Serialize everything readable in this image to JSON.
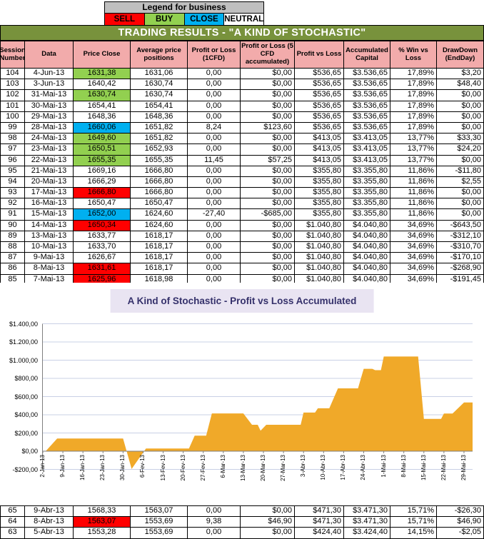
{
  "legend": {
    "title": "Legend for business",
    "items": [
      {
        "label": "SELL",
        "color": "#FF0000"
      },
      {
        "label": "BUY",
        "color": "#92D050"
      },
      {
        "label": "CLOSE",
        "color": "#00B0F0"
      },
      {
        "label": "NEUTRAL",
        "color": "#FFFFFF"
      }
    ]
  },
  "title_bar": "TRADING RESULTS - \"A KIND OF STOCHASTIC\"",
  "colors": {
    "header_pink": "#F2ABAB",
    "title_olive": "#78923C",
    "legend_gray": "#BFBFBF",
    "sell_red": "#FF0000",
    "buy_green": "#92D050",
    "close_blue": "#00B0F0",
    "grid": "#C9D0E5",
    "axis": "#7F7F7F",
    "chart_area": "#F0A929",
    "chart_title_bg": "#E9E4F2",
    "chart_title_text": "#35316B"
  },
  "table": {
    "headers": [
      "Session Number",
      "Data",
      "Price Close",
      "Average price positions",
      "Profit or Loss (1CFD)",
      "Profit or Loss (5 CFD accumulated)",
      "Profit vs Loss",
      "Accumulated Capital",
      "% Win vs Loss",
      "DrawDown (EndDay)"
    ],
    "rows_top": [
      {
        "cells": [
          "104",
          "4-Jun-13",
          "1631,38",
          "1631,06",
          "0,00",
          "$0,00",
          "$536,65",
          "$3.536,65",
          "17,89%",
          "$3,20"
        ],
        "price_color": "green"
      },
      {
        "cells": [
          "103",
          "3-Jun-13",
          "1640,42",
          "1630,74",
          "0,00",
          "$0,00",
          "$536,65",
          "$3.536,65",
          "17,89%",
          "$48,40"
        ],
        "price_color": "none"
      },
      {
        "cells": [
          "102",
          "31-Mai-13",
          "1630,74",
          "1630,74",
          "0,00",
          "$0,00",
          "$536,65",
          "$3.536,65",
          "17,89%",
          "$0,00"
        ],
        "price_color": "green"
      },
      {
        "cells": [
          "101",
          "30-Mai-13",
          "1654,41",
          "1654,41",
          "0,00",
          "$0,00",
          "$536,65",
          "$3.536,65",
          "17,89%",
          "$0,00"
        ],
        "price_color": "none"
      },
      {
        "cells": [
          "100",
          "29-Mai-13",
          "1648,36",
          "1648,36",
          "0,00",
          "$0,00",
          "$536,65",
          "$3.536,65",
          "17,89%",
          "$0,00"
        ],
        "price_color": "none"
      },
      {
        "cells": [
          "99",
          "28-Mai-13",
          "1660,06",
          "1651,82",
          "8,24",
          "$123,60",
          "$536,65",
          "$3.536,65",
          "17,89%",
          "$0,00"
        ],
        "price_color": "blue"
      },
      {
        "cells": [
          "98",
          "24-Mai-13",
          "1649,60",
          "1651,82",
          "0,00",
          "$0,00",
          "$413,05",
          "$3.413,05",
          "13,77%",
          "$33,30"
        ],
        "price_color": "green"
      },
      {
        "cells": [
          "97",
          "23-Mai-13",
          "1650,51",
          "1652,93",
          "0,00",
          "$0,00",
          "$413,05",
          "$3.413,05",
          "13,77%",
          "$24,20"
        ],
        "price_color": "green"
      },
      {
        "cells": [
          "96",
          "22-Mai-13",
          "1655,35",
          "1655,35",
          "11,45",
          "$57,25",
          "$413,05",
          "$3.413,05",
          "13,77%",
          "$0,00"
        ],
        "price_color": "green"
      },
      {
        "cells": [
          "95",
          "21-Mai-13",
          "1669,16",
          "1666,80",
          "0,00",
          "$0,00",
          "$355,80",
          "$3.355,80",
          "11,86%",
          "-$11,80"
        ],
        "price_color": "none"
      },
      {
        "cells": [
          "94",
          "20-Mai-13",
          "1666,29",
          "1666,80",
          "0,00",
          "$0,00",
          "$355,80",
          "$3.355,80",
          "11,86%",
          "$2,55"
        ],
        "price_color": "none"
      },
      {
        "cells": [
          "93",
          "17-Mai-13",
          "1666,80",
          "1666,80",
          "0,00",
          "$0,00",
          "$355,80",
          "$3.355,80",
          "11,86%",
          "$0,00"
        ],
        "price_color": "red"
      },
      {
        "cells": [
          "92",
          "16-Mai-13",
          "1650,47",
          "1650,47",
          "0,00",
          "$0,00",
          "$355,80",
          "$3.355,80",
          "11,86%",
          "$0,00"
        ],
        "price_color": "none"
      },
      {
        "cells": [
          "91",
          "15-Mai-13",
          "1652,00",
          "1624,60",
          "-27,40",
          "-$685,00",
          "$355,80",
          "$3.355,80",
          "11,86%",
          "$0,00"
        ],
        "price_color": "blue"
      },
      {
        "cells": [
          "90",
          "14-Mai-13",
          "1650,34",
          "1624,60",
          "0,00",
          "$0,00",
          "$1.040,80",
          "$4.040,80",
          "34,69%",
          "-$643,50"
        ],
        "price_color": "red"
      },
      {
        "cells": [
          "89",
          "13-Mai-13",
          "1633,77",
          "1618,17",
          "0,00",
          "$0,00",
          "$1.040,80",
          "$4.040,80",
          "34,69%",
          "-$312,10"
        ],
        "price_color": "none"
      },
      {
        "cells": [
          "88",
          "10-Mai-13",
          "1633,70",
          "1618,17",
          "0,00",
          "$0,00",
          "$1.040,80",
          "$4.040,80",
          "34,69%",
          "-$310,70"
        ],
        "price_color": "none"
      },
      {
        "cells": [
          "87",
          "9-Mai-13",
          "1626,67",
          "1618,17",
          "0,00",
          "$0,00",
          "$1.040,80",
          "$4.040,80",
          "34,69%",
          "-$170,10"
        ],
        "price_color": "none"
      },
      {
        "cells": [
          "86",
          "8-Mai-13",
          "1631,61",
          "1618,17",
          "0,00",
          "$0,00",
          "$1.040,80",
          "$4.040,80",
          "34,69%",
          "-$268,90"
        ],
        "price_color": "red"
      },
      {
        "cells": [
          "85",
          "7-Mai-13",
          "1625,96",
          "1618,98",
          "0,00",
          "$0,00",
          "$1.040,80",
          "$4.040,80",
          "34,69%",
          "-$191,45"
        ],
        "price_color": "red"
      }
    ],
    "rows_bottom": [
      {
        "cells": [
          "65",
          "9-Abr-13",
          "1568,33",
          "1563,07",
          "0,00",
          "$0,00",
          "$471,30",
          "$3.471,30",
          "15,71%",
          "-$26,30"
        ],
        "price_color": "none"
      },
      {
        "cells": [
          "64",
          "8-Abr-13",
          "1563,07",
          "1553,69",
          "9,38",
          "$46,90",
          "$471,30",
          "$3.471,30",
          "15,71%",
          "$46,90"
        ],
        "price_color": "red"
      },
      {
        "cells": [
          "63",
          "5-Abr-13",
          "1553,28",
          "1553,69",
          "0,00",
          "$0,00",
          "$424,40",
          "$3.424,40",
          "14,15%",
          "-$2,05"
        ],
        "price_color": "none"
      }
    ]
  },
  "chart_data": {
    "type": "area",
    "title": "A Kind of Stochastic - Profit vs Loss Accumulated",
    "series_name": "Profit vs Loss Accumulated",
    "series_color": "#F0A929",
    "ylim": [
      -200,
      1400
    ],
    "grid": true,
    "y_ticks": [
      "$1.400,00",
      "$1.200,00",
      "$1.000,00",
      "$800,00",
      "$600,00",
      "$400,00",
      "$200,00",
      "$0,00",
      "-$200,00"
    ],
    "y_tick_values": [
      1400,
      1200,
      1000,
      800,
      600,
      400,
      200,
      0,
      -200
    ],
    "x_ticks": [
      "2-Jan-13",
      "9-Jan-13",
      "16-Jan-13",
      "23-Jan-13",
      "30-Jan-13",
      "6-Fev-13",
      "13-Fev-13",
      "20-Fev-13",
      "27-Fev-13",
      "6-Mar-13",
      "13-Mar-13",
      "20-Mar-13",
      "27-Mar-13",
      "3-Abr-13",
      "10-Abr-13",
      "17-Abr-13",
      "24-Abr-13",
      "1-Mai-13",
      "8-Mai-13",
      "15-Mai-13",
      "22-Mai-13",
      "29-Mai-13"
    ],
    "tick_interval_days": 7,
    "x_range_days": [
      0,
      150
    ],
    "points": [
      [
        0,
        0
      ],
      [
        1,
        0
      ],
      [
        5,
        140
      ],
      [
        28,
        140
      ],
      [
        31,
        -195
      ],
      [
        36,
        30
      ],
      [
        51,
        30
      ],
      [
        53,
        170
      ],
      [
        57,
        170
      ],
      [
        59,
        415
      ],
      [
        70,
        415
      ],
      [
        73,
        290
      ],
      [
        75,
        290
      ],
      [
        76,
        225
      ],
      [
        78,
        290
      ],
      [
        90,
        290
      ],
      [
        91,
        424
      ],
      [
        95,
        424
      ],
      [
        96,
        471
      ],
      [
        100,
        471
      ],
      [
        103,
        690
      ],
      [
        107,
        690
      ],
      [
        110,
        690
      ],
      [
        112,
        905
      ],
      [
        115,
        905
      ],
      [
        116,
        890
      ],
      [
        118,
        890
      ],
      [
        119,
        1040
      ],
      [
        131,
        1040
      ],
      [
        133,
        355
      ],
      [
        139,
        355
      ],
      [
        140,
        413
      ],
      [
        143,
        413
      ],
      [
        147,
        536
      ],
      [
        150,
        536
      ]
    ]
  }
}
